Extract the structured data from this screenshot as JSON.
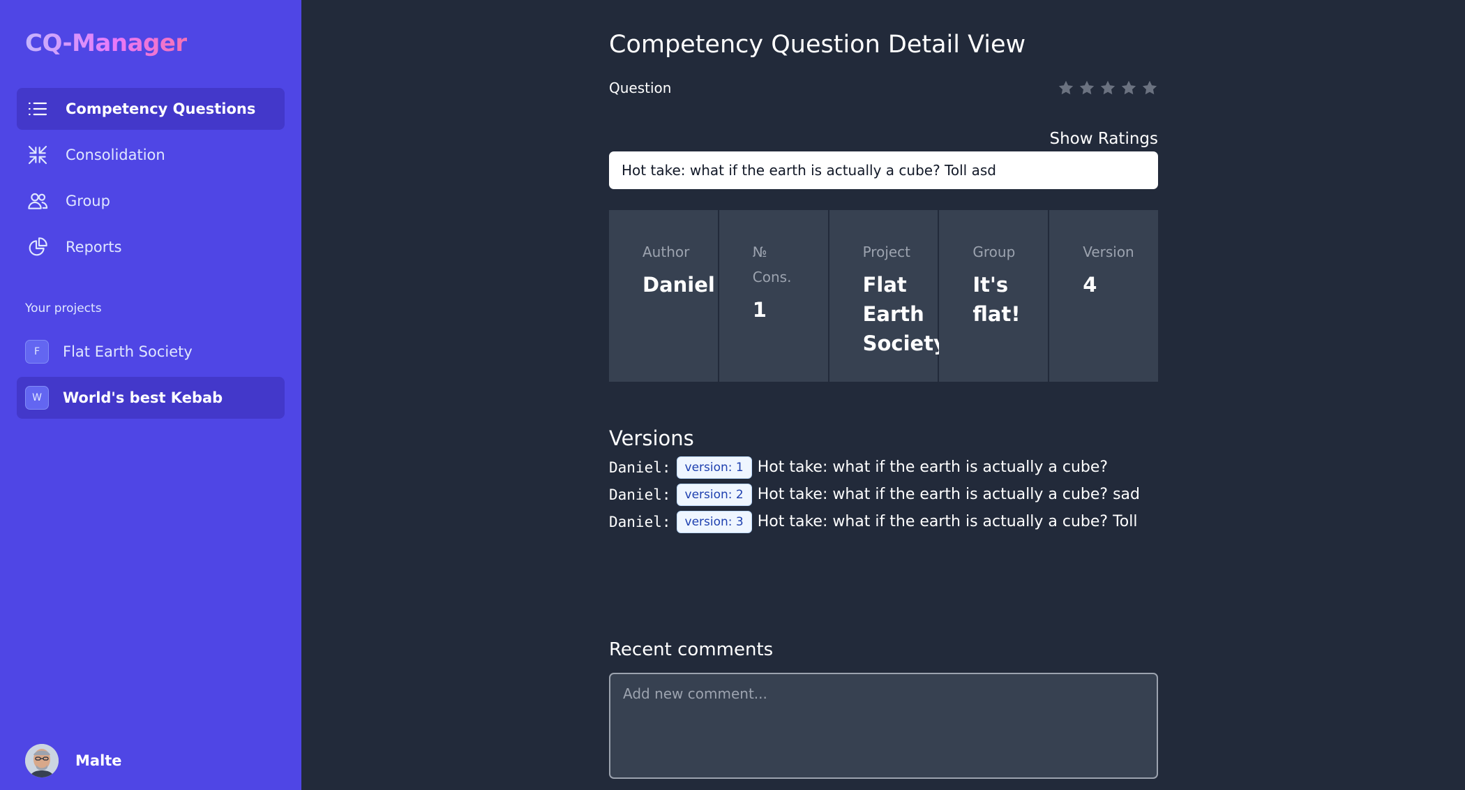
{
  "app": {
    "brand": "CQ-Manager"
  },
  "sidebar": {
    "nav": [
      {
        "label": "Competency Questions",
        "icon": "list-icon",
        "active": true
      },
      {
        "label": "Consolidation",
        "icon": "compress-arrows-icon",
        "active": false
      },
      {
        "label": "Group",
        "icon": "users-icon",
        "active": false
      },
      {
        "label": "Reports",
        "icon": "pie-chart-icon",
        "active": false
      }
    ],
    "projects_heading": "Your projects",
    "projects": [
      {
        "initial": "F",
        "label": "Flat Earth Society",
        "active": false
      },
      {
        "initial": "W",
        "label": "World's best Kebab",
        "active": true
      }
    ],
    "user": {
      "name": "Malte"
    }
  },
  "main": {
    "title": "Competency Question Detail View",
    "question_label": "Question",
    "rating": {
      "stars_filled": 0,
      "stars_total": 5
    },
    "show_ratings_label": "Show Ratings",
    "question_value": "Hot take: what if the earth is actually a cube? Toll asd",
    "stats": [
      {
        "label": "Author",
        "value": "Daniel"
      },
      {
        "label": "№ Cons.",
        "value": "1"
      },
      {
        "label": "Project",
        "value": "Flat Earth Society"
      },
      {
        "label": "Group",
        "value": "It's flat!"
      },
      {
        "label": "Version",
        "value": "4"
      }
    ],
    "versions_title": "Versions",
    "versions": [
      {
        "author": "Daniel:",
        "badge": "version: 1",
        "text": "Hot take: what if the earth is actually a cube?"
      },
      {
        "author": "Daniel:",
        "badge": "version: 2",
        "text": "Hot take: what if the earth is actually a cube? sad"
      },
      {
        "author": "Daniel:",
        "badge": "version: 3",
        "text": "Hot take: what if the earth is actually a cube? Toll"
      }
    ],
    "comments_title": "Recent comments",
    "comment_placeholder": "Add new comment..."
  },
  "colors": {
    "sidebar_bg": "#4f46e5",
    "sidebar_active": "#4338ca",
    "main_bg": "#222a3a",
    "card_bg": "#374151"
  }
}
